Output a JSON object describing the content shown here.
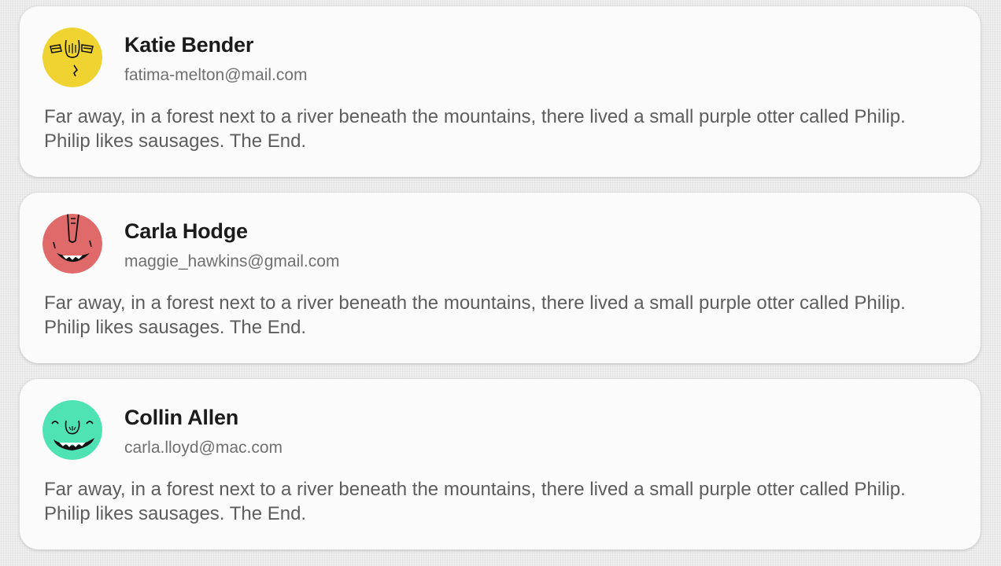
{
  "cards": [
    {
      "name": "Katie Bender",
      "email": "fatima-melton@mail.com",
      "text": "Far away, in a forest next to a river beneath the mountains, there lived a small purple otter called Philip. Philip likes sausages. The End.",
      "avatar_icon": "face-avatar-icon",
      "avatar_color": "#efd331"
    },
    {
      "name": "Carla Hodge",
      "email": "maggie_hawkins@gmail.com",
      "text": "Far away, in a forest next to a river beneath the mountains, there lived a small purple otter called Philip. Philip likes sausages. The End.",
      "avatar_icon": "face-avatar-icon",
      "avatar_color": "#e06a6a"
    },
    {
      "name": "Collin Allen",
      "email": "carla.lloyd@mac.com",
      "text": "Far away, in a forest next to a river beneath the mountains, there lived a small purple otter called Philip. Philip likes sausages. The End.",
      "avatar_icon": "face-avatar-icon",
      "avatar_color": "#4fe3b4"
    }
  ]
}
